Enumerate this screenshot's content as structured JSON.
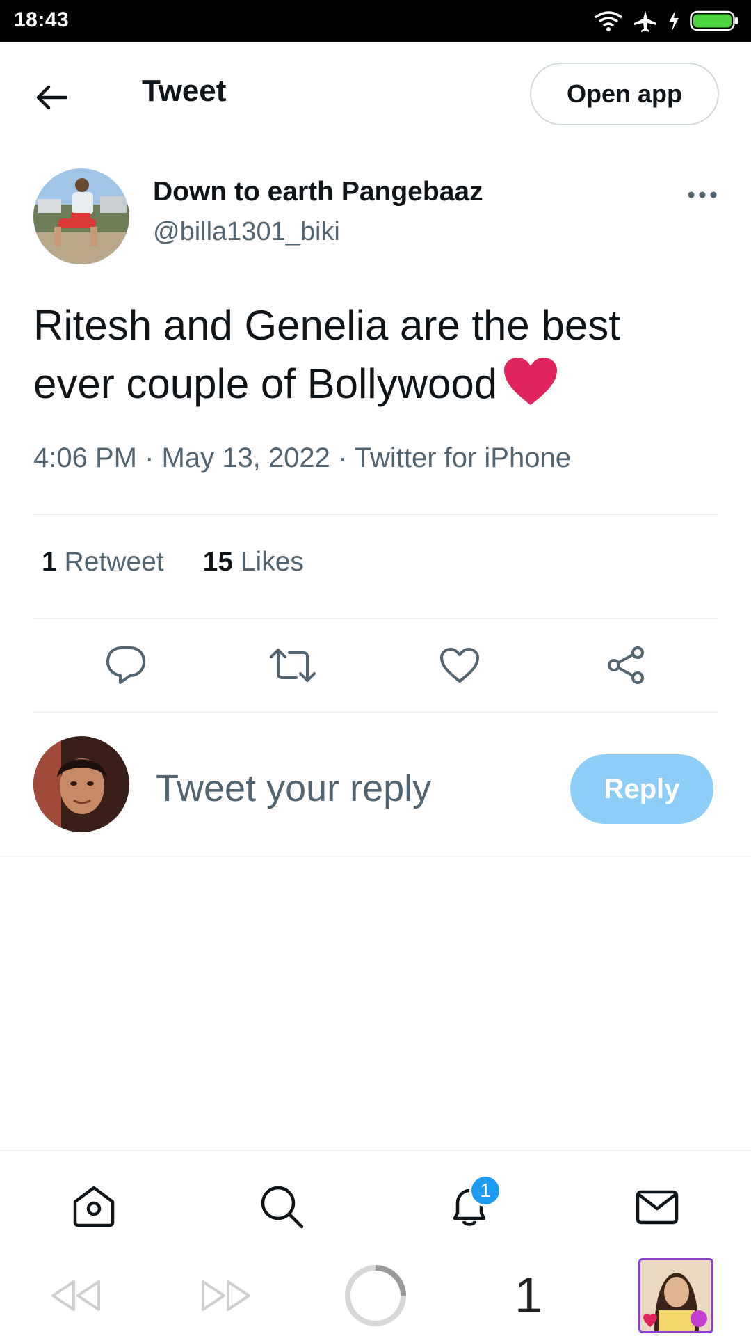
{
  "status_bar": {
    "time": "18:43"
  },
  "top_bar": {
    "title": "Tweet",
    "open_app_label": "Open app"
  },
  "tweet": {
    "author_name": "Down to earth Pangebaaz",
    "author_handle": "@billa1301_biki",
    "text": "Ritesh and Genelia are the best ever couple of Bollywood",
    "emoji": "red-heart-emoji",
    "meta": "4:06 PM · May 13, 2022 · Twitter for iPhone",
    "retweet_count": "1",
    "retweet_label": "Retweet",
    "likes_count": "15",
    "likes_label": "Likes"
  },
  "reply": {
    "placeholder": "Tweet your reply",
    "button_label": "Reply"
  },
  "bottom_nav": {
    "items": [
      "home-icon",
      "search-icon",
      "notifications-icon",
      "messages-icon"
    ],
    "notification_badge": "1"
  },
  "browser_bar": {
    "tab_count": "1"
  },
  "colors": {
    "accent": "#1d9bf0",
    "reply_button": "#8ecdf8",
    "heart": "#e0245e",
    "secondary_text": "#536471"
  }
}
